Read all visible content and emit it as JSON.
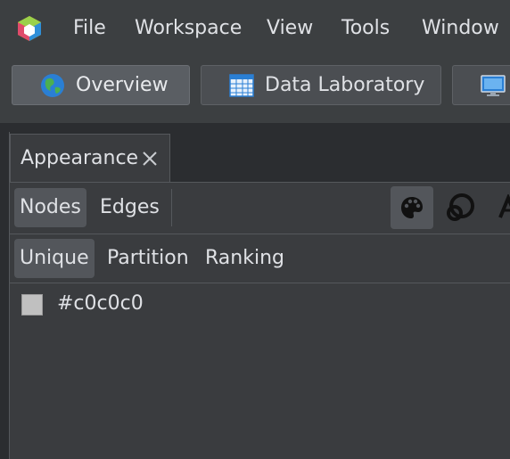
{
  "menu": {
    "items": [
      "File",
      "Workspace",
      "View",
      "Tools",
      "Window"
    ],
    "logo_icon": "gephi-logo-icon"
  },
  "workspace": {
    "buttons": [
      {
        "label": "Overview",
        "icon": "globe-icon",
        "active": true
      },
      {
        "label": "Data Laboratory",
        "icon": "spreadsheet-icon",
        "active": false
      },
      {
        "label": "",
        "icon": "monitor-icon",
        "active": false
      }
    ]
  },
  "appearance": {
    "tab_title": "Appearance",
    "element_toggles": {
      "nodes": "Nodes",
      "edges": "Edges",
      "selected": "Nodes"
    },
    "property_icons": [
      "palette-icon",
      "size-icon",
      "label-color-icon"
    ],
    "modes": {
      "unique": "Unique",
      "partition": "Partition",
      "ranking": "Ranking",
      "selected": "Unique"
    },
    "color": {
      "value": "#c0c0c0",
      "label": "#c0c0c0"
    }
  }
}
